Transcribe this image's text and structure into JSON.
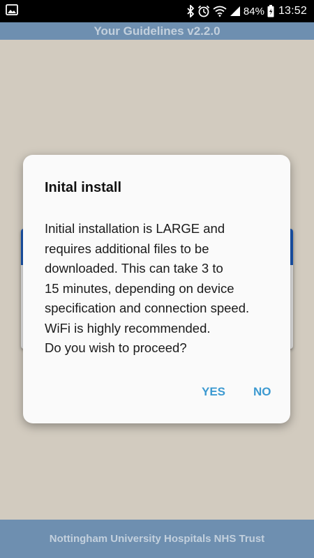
{
  "status_bar": {
    "battery_percent": "84%",
    "time": "13:52",
    "icons": [
      "gallery-icon",
      "bluetooth-icon",
      "alarm-icon",
      "wifi-icon",
      "signal-icon",
      "battery-icon"
    ]
  },
  "app_bar": {
    "title": "Your Guidelines v2.2.0"
  },
  "dialog": {
    "title": "Inital install",
    "lines": [
      "Initial installation is LARGE and",
      "requires additional files to be",
      "downloaded. This can take 3 to",
      "15 minutes, depending on device",
      "specification and connection speed.",
      "WiFi is highly recommended.",
      "Do you wish to proceed?"
    ],
    "yes_label": "YES",
    "no_label": "NO"
  },
  "footer": {
    "text": "Nottingham University Hospitals NHS Trust"
  },
  "colors": {
    "app_bar": "#6e8fb0",
    "app_bar_text": "#c3d0dd",
    "background": "#d2cbbf",
    "card_header": "#1b57b3",
    "button_text": "#3d9ad1"
  }
}
